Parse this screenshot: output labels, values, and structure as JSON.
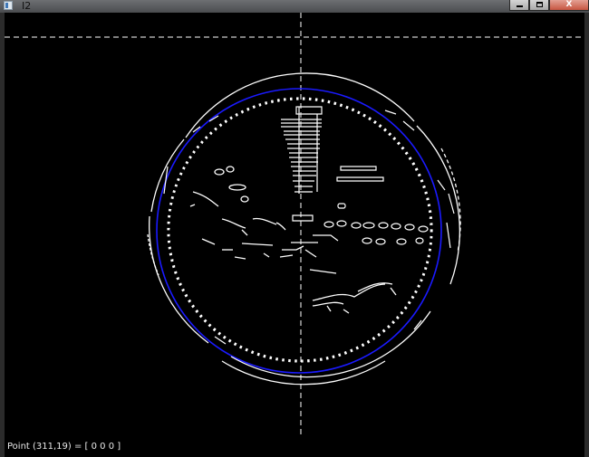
{
  "window": {
    "title": "I2",
    "icon": "opencv-window-icon",
    "buttons": [
      {
        "name": "minimize",
        "icon": "minimize-icon"
      },
      {
        "name": "maximize",
        "icon": "maximize-icon"
      },
      {
        "name": "close",
        "icon": "close-icon",
        "label": "X"
      }
    ]
  },
  "image": {
    "description_type": "edge-detected coin image",
    "colors": {
      "background": "#000000",
      "edges": "#ffffff",
      "fitted_circle": "#1a1aff",
      "crosshair": "#ffffff"
    }
  },
  "statusbar": {
    "text": "Point (311,19) = [ 0 0 0 ]"
  }
}
